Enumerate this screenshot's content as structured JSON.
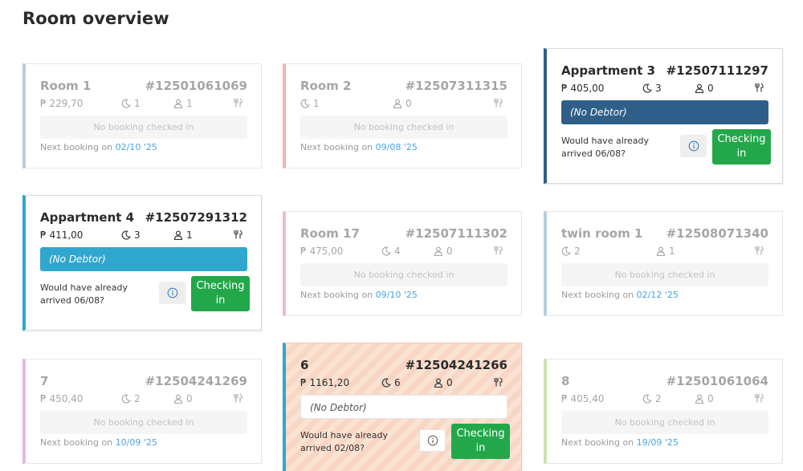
{
  "page": {
    "title": "Room overview"
  },
  "labels": {
    "empty": "No booking checked in",
    "next_prefix": "Next booking on "
  },
  "colors": {
    "checkin_button": "#22a84a",
    "next_date_link": "#4aa3e6",
    "debtor_dark": "#2f5f88",
    "debtor_light": "#2fa7cf"
  },
  "rooms": [
    {
      "name": "Room 1",
      "number": "#12501061069",
      "price": "₱ 229,70",
      "nights": "1",
      "guests": "1",
      "next_date": "02/10 '25",
      "accent": "#b9cfe0"
    },
    {
      "name": "Room 2",
      "number": "#12507311315",
      "price": "",
      "nights": "1",
      "guests": "0",
      "next_date": "09/08 '25",
      "accent": "#f2b3b3"
    },
    {
      "name": "Appartment 3",
      "number": "#12507111297",
      "price": "₱ 405,00",
      "nights": "3",
      "guests": "0",
      "debtor": "(No Debtor)",
      "note": "Would have already arrived 06/08?",
      "checkin": "Checking in",
      "accent": "#2f5f88"
    },
    {
      "name": "Appartment 4",
      "number": "#12507291312",
      "price": "₱ 411,00",
      "nights": "3",
      "guests": "1",
      "debtor": "(No Debtor)",
      "note": "Would have already arrived 06/08?",
      "checkin": "Checking in",
      "accent": "#2fa7cf"
    },
    {
      "name": "Room 17",
      "number": "#12507111302",
      "price": "₱ 475,00",
      "nights": "4",
      "guests": "0",
      "next_date": "09/10 '25",
      "accent": "#f3b7cc"
    },
    {
      "name": "twin room 1",
      "number": "#12508071340",
      "price": "",
      "nights": "2",
      "guests": "1",
      "next_date": "02/12 '25",
      "accent": "#b9cfe0"
    },
    {
      "name": "7",
      "number": "#12504241269",
      "price": "₱ 450,40",
      "nights": "2",
      "guests": "0",
      "next_date": "10/09 '25",
      "accent": "#e2b8e6"
    },
    {
      "name": "6",
      "number": "#12504241266",
      "price": "₱ 1161,20",
      "nights": "6",
      "guests": "0",
      "debtor": "(No Debtor)",
      "note": "Would have already arrived 02/08?",
      "checkin": "Checking in",
      "accent": "#2fa7cf"
    },
    {
      "name": "8",
      "number": "#12501061064",
      "price": "₱ 405,40",
      "nights": "2",
      "guests": "0",
      "next_date": "19/09 '25",
      "accent": "#cfe0b0"
    }
  ]
}
